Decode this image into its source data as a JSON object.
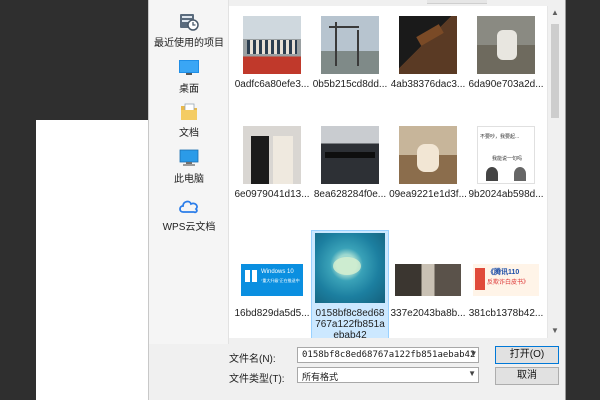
{
  "sidebar": {
    "items": [
      {
        "label": "最近使用的项目",
        "icon": "recent-items-icon"
      },
      {
        "label": "桌面",
        "icon": "desktop-icon"
      },
      {
        "label": "文档",
        "icon": "documents-icon"
      },
      {
        "label": "此电脑",
        "icon": "this-pc-icon"
      },
      {
        "label": "WPS云文档",
        "icon": "cloud-icon"
      }
    ]
  },
  "files": [
    {
      "name": "0adfc6a80efe3..."
    },
    {
      "name": "0b5b215cd8dd..."
    },
    {
      "name": "4ab38376dac3..."
    },
    {
      "name": "6da90e703a2d..."
    },
    {
      "name": "6e0979041d13..."
    },
    {
      "name": "8ea628284f0e..."
    },
    {
      "name": "09ea9221e1d3f..."
    },
    {
      "name": "9b2024ab598d..."
    },
    {
      "name": "16bd829da5d5..."
    },
    {
      "name": "0158bf8c8ed68767a122fb851aebab42"
    },
    {
      "name": "337e2043ba8b..."
    },
    {
      "name": "381cb1378b42..."
    }
  ],
  "thumb_text": {
    "win10_title": "Windows 10",
    "win10_sub": "“重大升级”正在推送中",
    "tencent_title": "《腾讯110",
    "tencent_sub": "反欺诈白皮书》",
    "comic_a": "不要吵，我要起...",
    "comic_b": "我能说一句吗"
  },
  "form": {
    "filename_label": "文件名(N):",
    "filename_value": "0158bf8c8ed68767a122fb851aebab42",
    "filetype_label": "文件类型(T):",
    "filetype_value": "所有格式",
    "open_button": "打开(O)",
    "cancel_button": "取消"
  },
  "colors": {
    "accent": "#0078d7",
    "selection": "#cce8ff"
  }
}
